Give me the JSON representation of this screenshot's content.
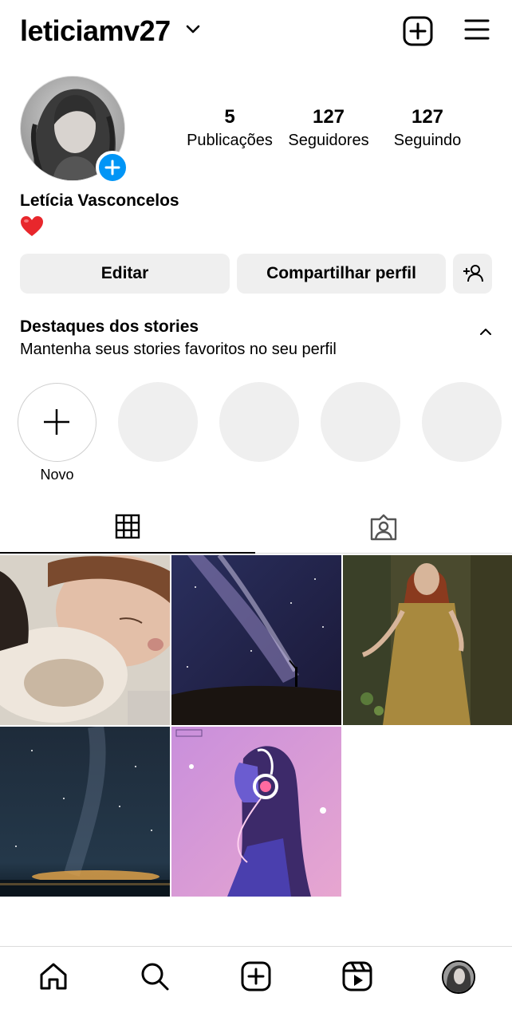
{
  "header": {
    "username": "leticiamv27",
    "chevron_icon": "chevron-down-icon",
    "create_icon": "plus-square-icon",
    "menu_icon": "hamburger-menu-icon"
  },
  "profile": {
    "avatar_icon": "profile-photo",
    "add_story_icon": "plus-circle-icon",
    "stats": [
      {
        "value": "5",
        "label": "Publicações"
      },
      {
        "value": "127",
        "label": "Seguidores"
      },
      {
        "value": "127",
        "label": "Seguindo"
      }
    ],
    "full_name": "Letícia Vasconcelos",
    "bio_emoji": "heart-emoji",
    "accent_color": "#0095f6",
    "heart_color": "#e8272c"
  },
  "actions": {
    "edit_label": "Editar",
    "share_label": "Compartilhar perfil",
    "add_friend_icon": "person-add-icon"
  },
  "highlights": {
    "title": "Destaques dos stories",
    "subtitle": "Mantenha seus stories favoritos no seu perfil",
    "collapse_icon": "chevron-up-icon",
    "new_label": "Novo",
    "placeholder_count": 4
  },
  "tabs": {
    "grid_icon": "grid-icon",
    "tagged_icon": "tagged-person-icon",
    "active": "grid"
  },
  "posts": [
    {
      "subject": "woman-cuddling-cat-photo"
    },
    {
      "subject": "milky-way-night-sky-silhouette"
    },
    {
      "subject": "woman-in-gold-dress-forest"
    },
    {
      "subject": "starry-sky-over-water"
    },
    {
      "subject": "illustrated-girl-with-headphones"
    }
  ],
  "bottom_nav": {
    "home_icon": "home-icon",
    "search_icon": "search-icon",
    "create_icon": "plus-square-icon",
    "reels_icon": "reels-icon",
    "profile_icon": "profile-avatar-icon"
  }
}
